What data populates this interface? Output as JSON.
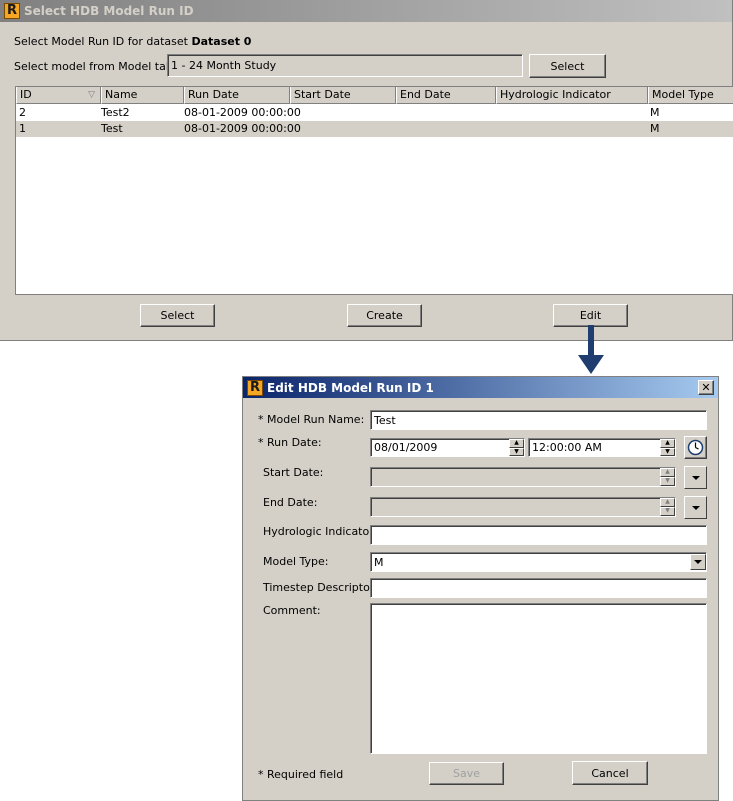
{
  "window1": {
    "title": "Select HDB Model Run ID",
    "dataset_prefix": "Select Model Run ID for dataset",
    "dataset_name": "Dataset 0",
    "model_label": "Select model from Model table:",
    "model_value": "1 - 24 Month Study",
    "model_select_button": "Select",
    "table": {
      "columns": [
        "ID",
        "Name",
        "Run Date",
        "Start Date",
        "End Date",
        "Hydrologic Indicator",
        "Model Type"
      ],
      "rows": [
        {
          "id": "2",
          "name": "Test2",
          "run_date": "08-01-2009 00:00:00",
          "start_date": "",
          "end_date": "",
          "hydrologic": "",
          "model_type": "M"
        },
        {
          "id": "1",
          "name": "Test",
          "run_date": "08-01-2009 00:00:00",
          "start_date": "",
          "end_date": "",
          "hydrologic": "",
          "model_type": "M"
        }
      ]
    },
    "buttons": {
      "select": "Select",
      "create": "Create",
      "edit": "Edit"
    }
  },
  "arrow_color": "#1f3e6f",
  "window2": {
    "title": "Edit HDB Model Run ID 1",
    "close_label": "✕",
    "required_mark": "*",
    "model_run_name_label": "Model Run Name:",
    "model_run_name_value": "Test",
    "run_date_label": "Run Date:",
    "run_date_value": "08/01/2009",
    "run_time_value": "12:00:00 AM",
    "start_date_label": "Start Date:",
    "end_date_label": "End Date:",
    "hydrologic_label": "Hydrologic Indicator:",
    "hydrologic_value": "",
    "model_type_label": "Model Type:",
    "model_type_value": "M",
    "timestep_label": "Timestep Descriptor:",
    "timestep_value": "",
    "comment_label": "Comment:",
    "comment_value": "",
    "required_note": "Required field",
    "save_button": "Save",
    "cancel_button": "Cancel"
  }
}
